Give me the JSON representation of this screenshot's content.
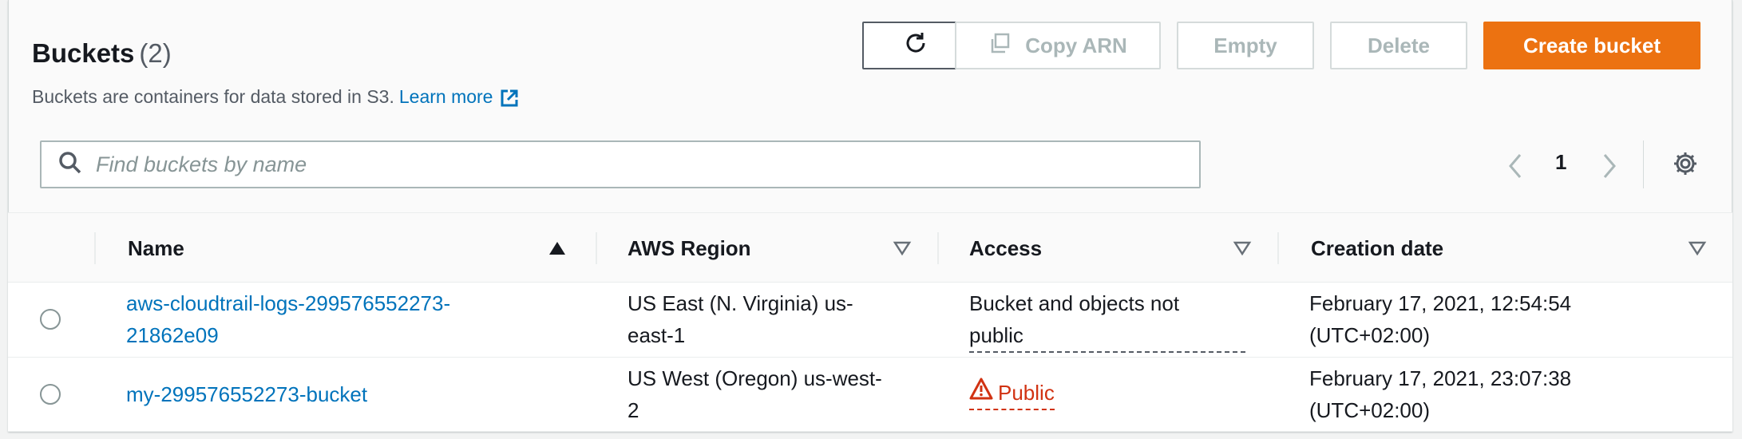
{
  "header": {
    "title": "Buckets",
    "count": "(2)",
    "description": "Buckets are containers for data stored in S3.",
    "learn_more": "Learn more"
  },
  "toolbar": {
    "refresh_icon": "refresh-icon",
    "copy_arn_label": "Copy ARN",
    "empty_label": "Empty",
    "delete_label": "Delete",
    "create_label": "Create bucket"
  },
  "search": {
    "placeholder": "Find buckets by name",
    "value": ""
  },
  "pagination": {
    "current_page": "1"
  },
  "table": {
    "columns": [
      {
        "label": "Name",
        "sort": "ascending"
      },
      {
        "label": "AWS Region",
        "sort": "none"
      },
      {
        "label": "Access",
        "sort": "none"
      },
      {
        "label": "Creation date",
        "sort": "none"
      }
    ],
    "rows": [
      {
        "name_line1": "aws-cloudtrail-logs-299576552273-",
        "name_line2": "21862e09",
        "region_line1": "US East (N. Virginia) us-",
        "region_line2": "east-1",
        "access_line1": "Bucket and objects not",
        "access_line2": "public",
        "date_line1": "February 17, 2021, 12:54:54",
        "date_line2": "(UTC+02:00)"
      },
      {
        "name_line1": "my-299576552273-bucket",
        "region_line1": "US West (Oregon) us-west-",
        "region_line2": "2",
        "access_line1": "Public",
        "date_line1": "February 17, 2021, 23:07:38",
        "date_line2": "(UTC+02:00)"
      }
    ]
  },
  "colors": {
    "primary": "#ec7211",
    "link": "#0073bb",
    "warning": "#d13212"
  }
}
